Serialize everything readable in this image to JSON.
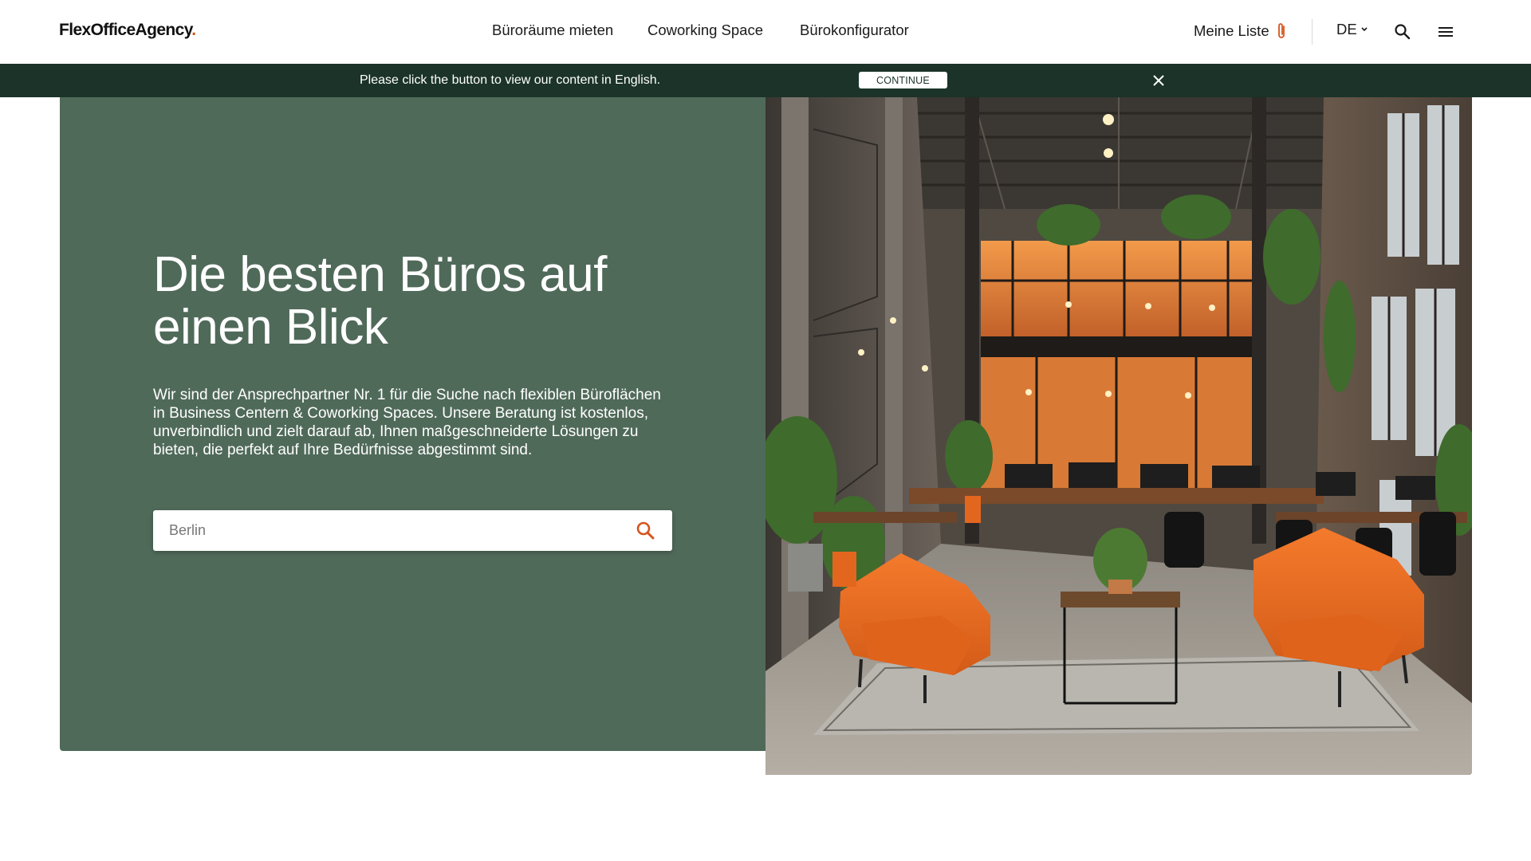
{
  "header": {
    "logo_main": "FlexOfficeAgency",
    "logo_dot": ".",
    "nav": [
      {
        "label": "Büroräume mieten"
      },
      {
        "label": "Coworking Space"
      },
      {
        "label": "Bürokonfigurator"
      }
    ],
    "my_list_label": "Meine Liste",
    "language": "DE"
  },
  "banner": {
    "text": "Please click the button to view our content in English.",
    "button_label": "CONTINUE"
  },
  "hero": {
    "title": "Die besten Büros auf einen Blick",
    "description": "Wir sind der Ansprechpartner Nr. 1 für die Suche nach flexiblen Büroflächen in Business Centern & Coworking Spaces. Unsere Beratung ist kostenlos, unverbindlich und zielt darauf ab, Ihnen maßgeschneiderte Lösungen zu bieten, die perfekt auf Ihre Bedürfnisse abgestimmt sind.",
    "search_placeholder": "Berlin"
  },
  "colors": {
    "brand_accent": "#d4551f",
    "banner_bg": "#1b3329",
    "hero_panel_bg": "#506a5a"
  },
  "icons": {
    "list": "paperclip-icon",
    "language": "chevron-down-icon",
    "search": "search-icon",
    "menu": "hamburger-menu-icon",
    "close": "close-icon"
  }
}
